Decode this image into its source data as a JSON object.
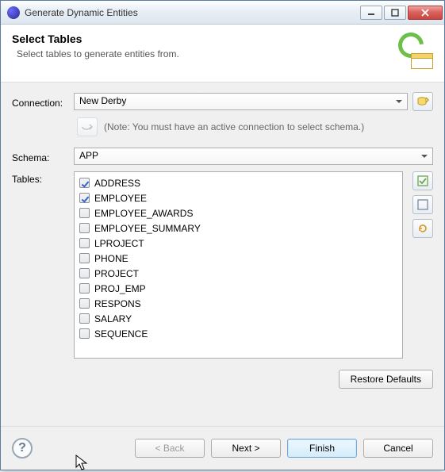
{
  "window": {
    "title": "Generate Dynamic Entities"
  },
  "header": {
    "title": "Select Tables",
    "subtitle": "Select tables to generate entities from."
  },
  "connection": {
    "label": "Connection:",
    "value": "New Derby",
    "note": "(Note: You must have an active connection to select schema.)"
  },
  "schema": {
    "label": "Schema:",
    "value": "APP"
  },
  "tables": {
    "label": "Tables:",
    "items": [
      {
        "name": "ADDRESS",
        "checked": true
      },
      {
        "name": "EMPLOYEE",
        "checked": true
      },
      {
        "name": "EMPLOYEE_AWARDS",
        "checked": false
      },
      {
        "name": "EMPLOYEE_SUMMARY",
        "checked": false
      },
      {
        "name": "LPROJECT",
        "checked": false
      },
      {
        "name": "PHONE",
        "checked": false
      },
      {
        "name": "PROJECT",
        "checked": false
      },
      {
        "name": "PROJ_EMP",
        "checked": false
      },
      {
        "name": "RESPONS",
        "checked": false
      },
      {
        "name": "SALARY",
        "checked": false
      },
      {
        "name": "SEQUENCE",
        "checked": false
      }
    ]
  },
  "buttons": {
    "restore": "Restore Defaults",
    "back": "< Back",
    "next": "Next >",
    "finish": "Finish",
    "cancel": "Cancel"
  }
}
